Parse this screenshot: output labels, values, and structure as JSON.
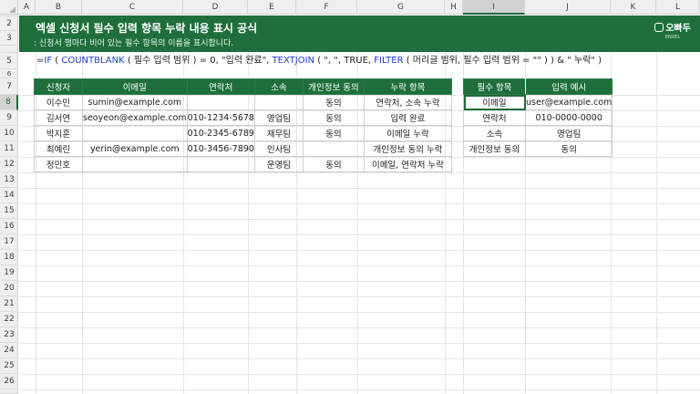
{
  "columns": [
    "A",
    "B",
    "C",
    "D",
    "E",
    "F",
    "G",
    "H",
    "I",
    "J",
    "K",
    "L"
  ],
  "selected_column": "I",
  "rows": [
    "1",
    "2",
    "3",
    "4",
    "5",
    "6",
    "7",
    "8",
    "9",
    "10",
    "11",
    "12",
    "13",
    "14",
    "15",
    "16",
    "17",
    "18",
    "19",
    "20",
    "21",
    "22",
    "23",
    "24",
    "25",
    "26",
    "27"
  ],
  "selected_row": "8",
  "banner": {
    "title": "엑셀 신청서 필수 입력 항목 누락 내용 표시 공식",
    "subtitle": ": 신청서 행마다 비어 있는 필수 항목의 이름을 표시합니다.",
    "logo_name": "오빠두",
    "logo_sub": "ENXEL"
  },
  "formula": {
    "p1": "=",
    "f1": "IF",
    "p2": " ( ",
    "f2": "COUNTBLANK",
    "p3": " ( 필수 입력 범위 ) = 0, \"입력 완료\", ",
    "f3": "TEXTJOIN",
    "p4": " ( \", \", TRUE, ",
    "f4": "FILTER",
    "p5": " ( 머리글 범위, 필수 입력 범위 = \"\" ) ) & \" 누락\" )"
  },
  "main_table": {
    "headers": [
      "신청자",
      "이메일",
      "연락처",
      "소속",
      "개인정보 동의",
      "누락 항목"
    ],
    "rows": [
      [
        "이수민",
        "sumin@example.com",
        "",
        "",
        "동의",
        "연락처, 소속 누락"
      ],
      [
        "김서연",
        "seoyeon@example.com",
        "010-1234-5678",
        "영업팀",
        "동의",
        "입력 완료"
      ],
      [
        "박지훈",
        "",
        "010-2345-6789",
        "재무팀",
        "동의",
        "이메일 누락"
      ],
      [
        "최예린",
        "yerin@example.com",
        "010-3456-7890",
        "인사팀",
        "",
        "개인정보 동의 누락"
      ],
      [
        "정민호",
        "",
        "",
        "운영팀",
        "동의",
        "이메일, 연락처 누락"
      ]
    ]
  },
  "side_table": {
    "headers": [
      "필수 항목",
      "입력 예시"
    ],
    "rows": [
      [
        "이메일",
        "user@example.com"
      ],
      [
        "연락처",
        "010-0000-0000"
      ],
      [
        "소속",
        "영업팀"
      ],
      [
        "개인정보 동의",
        "동의"
      ]
    ]
  }
}
